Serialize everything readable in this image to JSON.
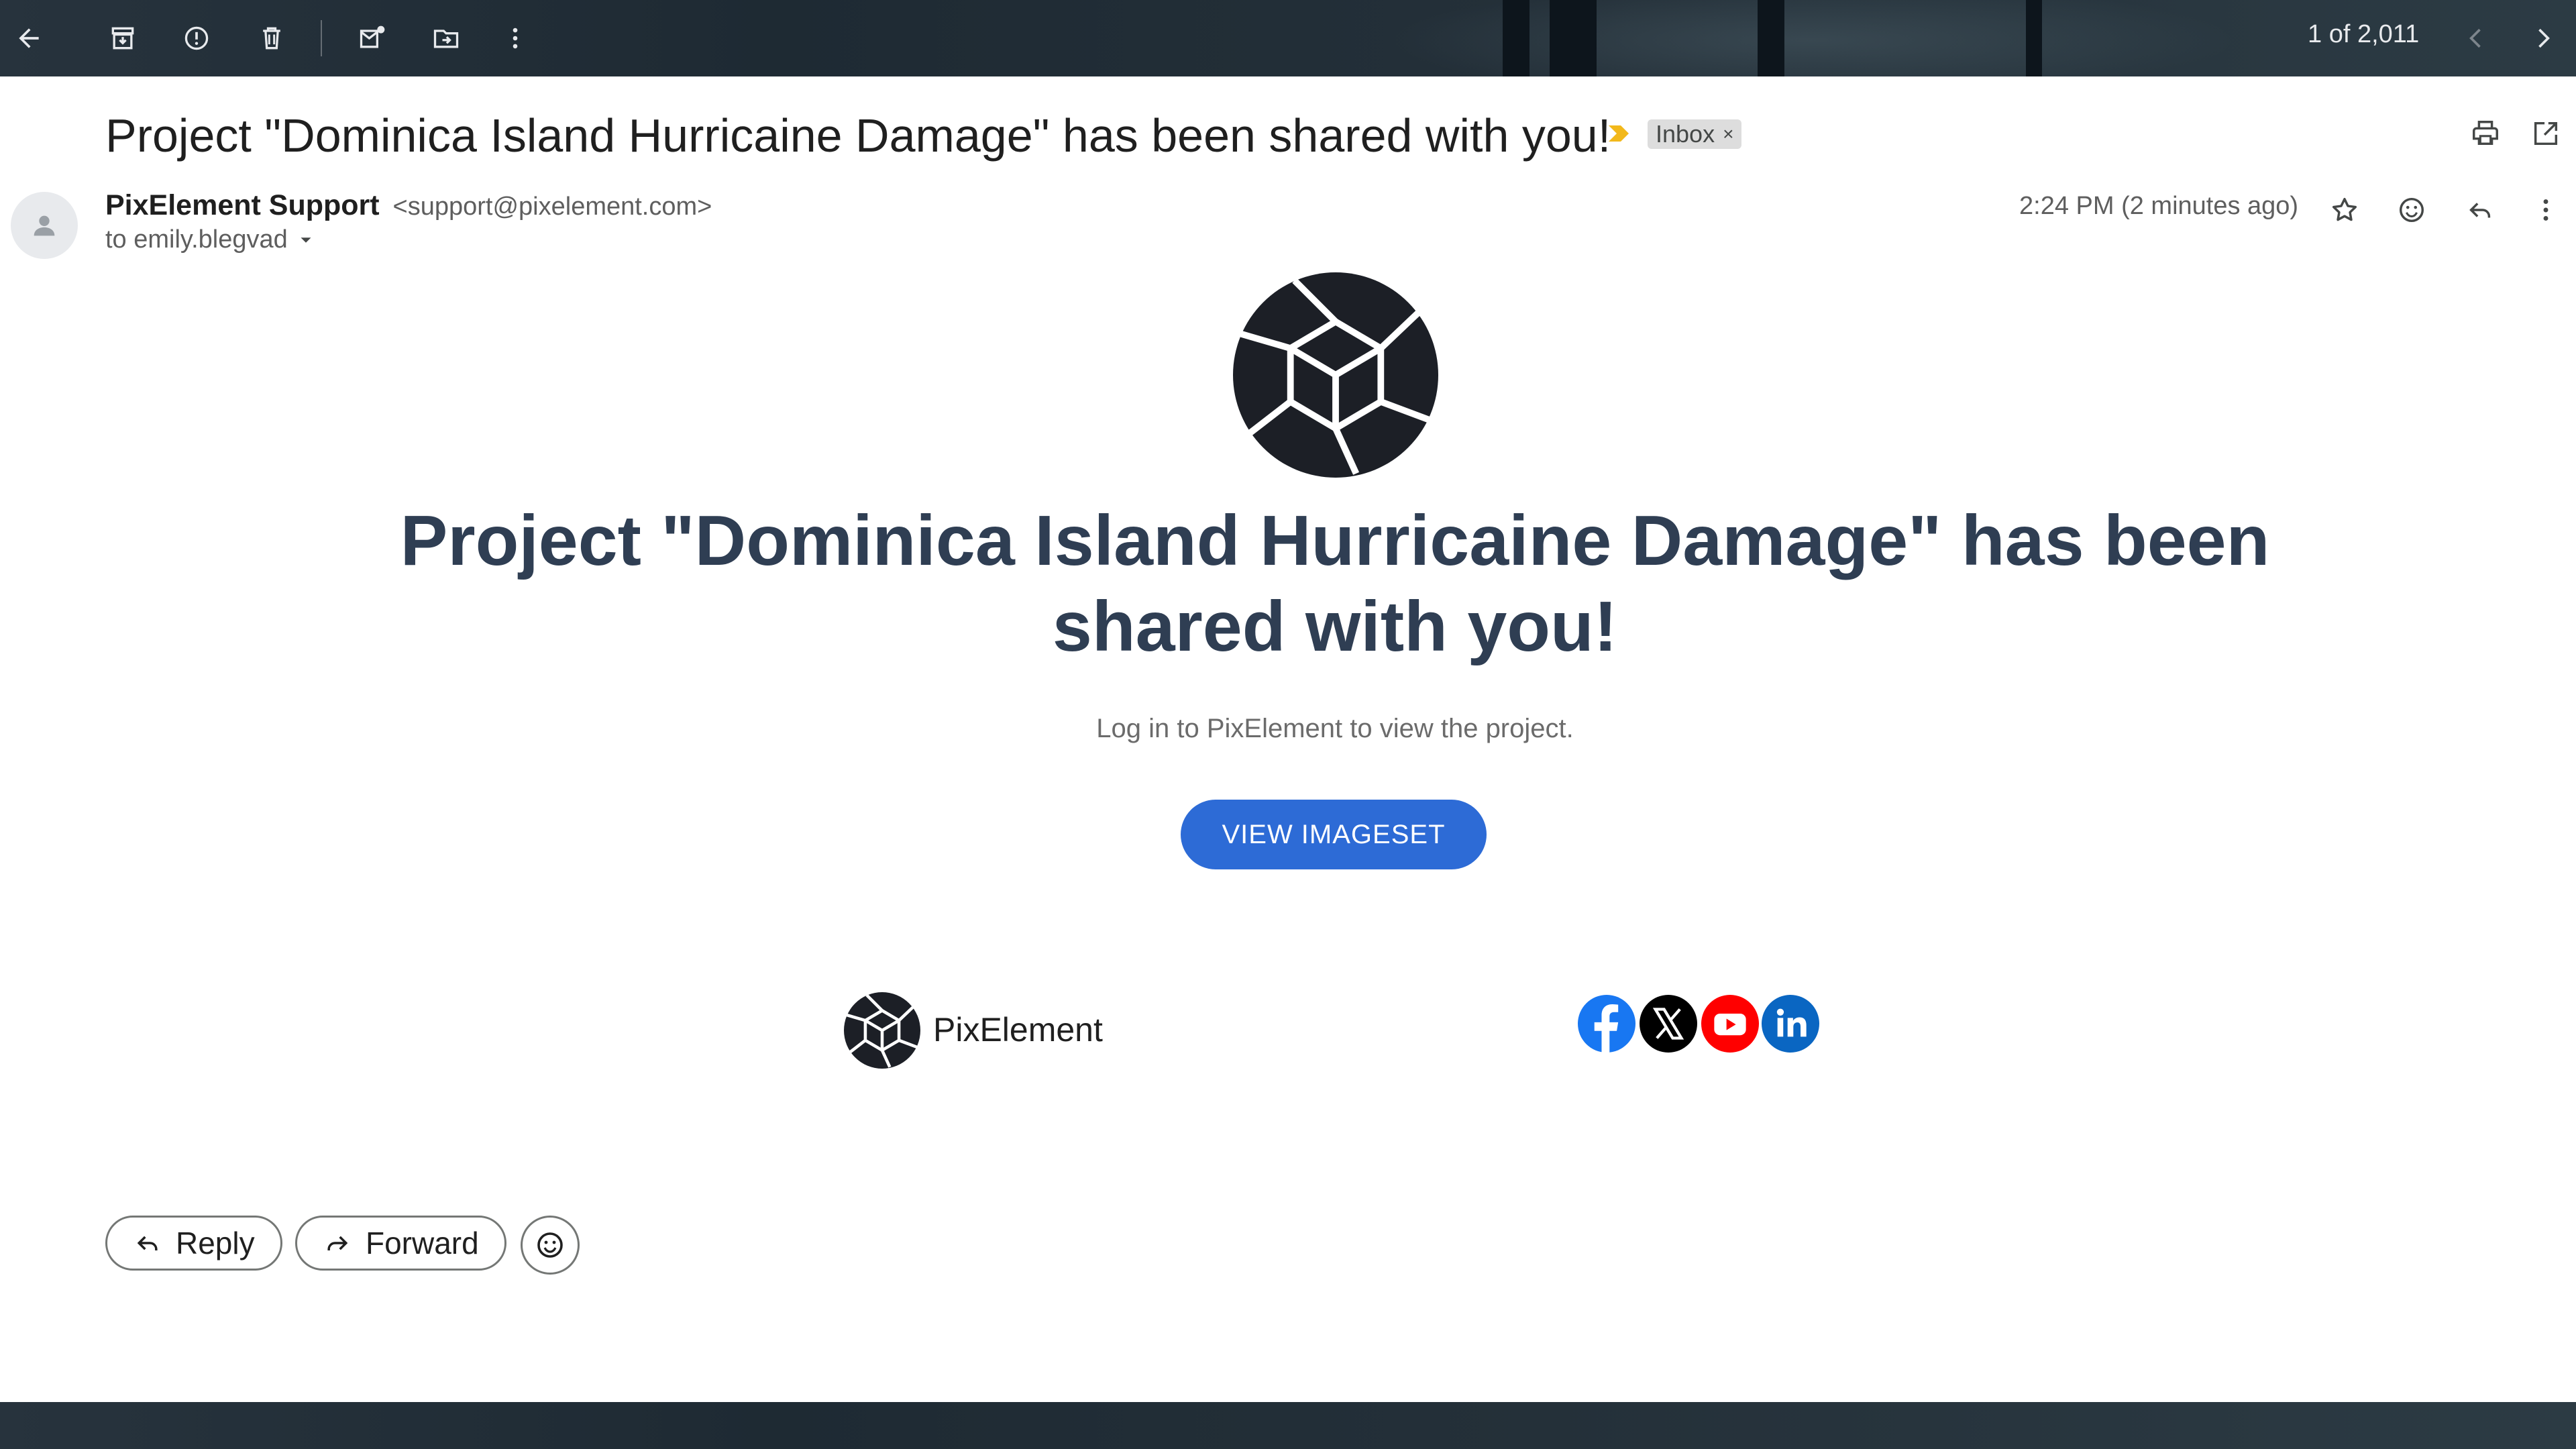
{
  "toolbar": {
    "pager_text": "1 of 2,011",
    "icons": [
      "back-arrow-icon",
      "archive-icon",
      "report-spam-icon",
      "delete-icon",
      "mark-unread-icon",
      "move-to-icon",
      "more-vert-icon",
      "chevron-left-icon",
      "chevron-right-icon"
    ]
  },
  "email": {
    "subject": "Project \"Dominica Island Hurricaine Damage\" has been shared with you!",
    "label": "Inbox",
    "label_remove": "×",
    "sender_name": "PixElement Support",
    "sender_email": "<support@pixelement.com>",
    "to_text": "to emily.blegvad",
    "time": "2:24 PM (2 minutes ago)"
  },
  "body": {
    "headline": "Project \"Dominica Island Hurricaine Damage\" has been shared with you!",
    "subtext": "Log in to PixElement to view the project.",
    "cta_label": "VIEW IMAGESET",
    "footer_brand": "PixElement",
    "socials": [
      "facebook",
      "x",
      "youtube",
      "linkedin"
    ]
  },
  "actions": {
    "reply_label": "Reply",
    "forward_label": "Forward"
  },
  "colors": {
    "accent": "#2d6bd6",
    "headline": "#2f3e53",
    "facebook": "#1877f2",
    "youtube": "#ff0000",
    "linkedin": "#0a66c2",
    "label_marker": "#f2b81b"
  }
}
